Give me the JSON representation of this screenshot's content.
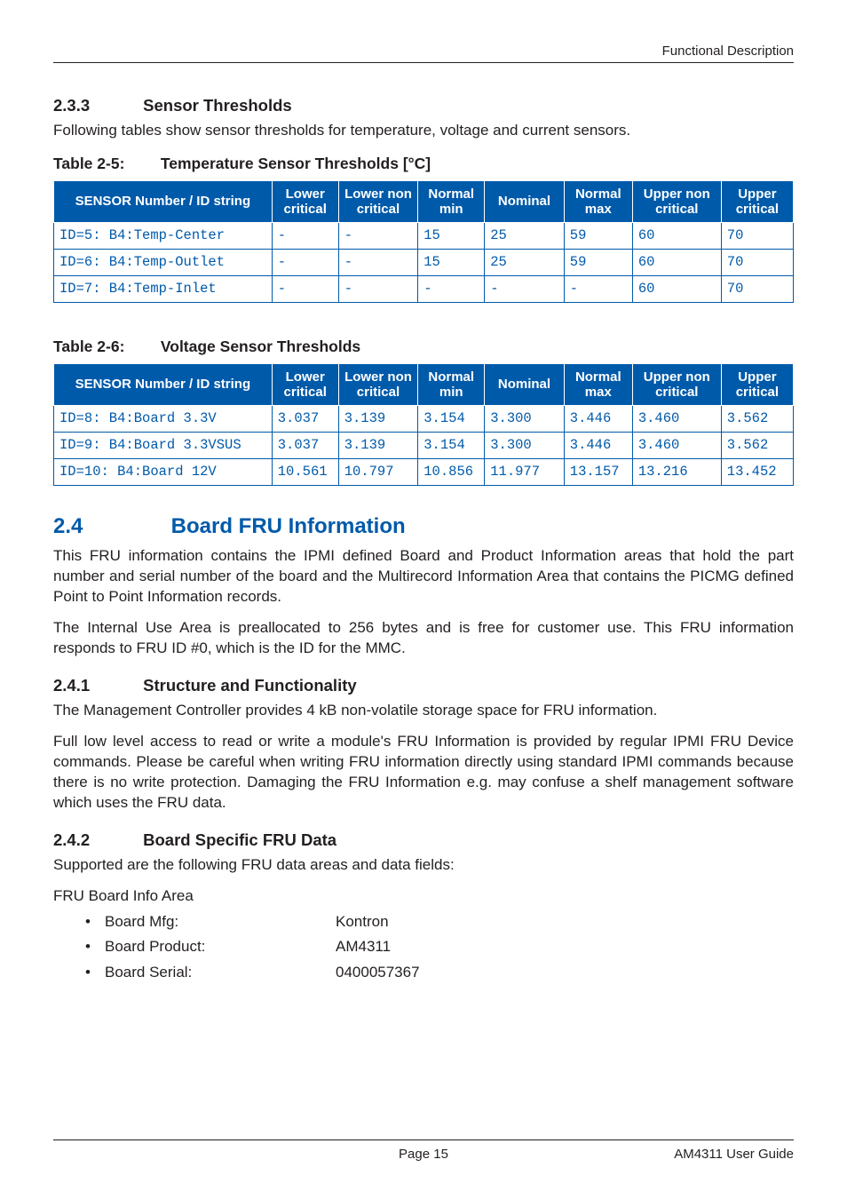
{
  "running_header": "Functional Description",
  "sections": {
    "s233": {
      "number": "2.3.3",
      "title": "Sensor Thresholds"
    },
    "s233_para": "Following tables show sensor thresholds for temperature, voltage and current sensors.",
    "table25_caption_num": "Table 2-5:",
    "table25_caption": "Temperature Sensor Thresholds [°C]",
    "table26_caption_num": "Table 2-6:",
    "table26_caption": "Voltage Sensor Thresholds",
    "s24": {
      "number": "2.4",
      "title": "Board FRU Information"
    },
    "s24_para1": "This FRU information contains the IPMI defined Board and Product Information areas that hold the part number and serial number of the board and the Multirecord Information Area that contains the PICMG defined Point to Point Information records.",
    "s24_para2": "The Internal Use Area is preallocated to 256 bytes and is free for customer use. This FRU information responds to FRU ID #0, which is the ID for the MMC.",
    "s241": {
      "number": "2.4.1",
      "title": "Structure and Functionality"
    },
    "s241_para1": "The Management Controller provides 4 kB non-volatile storage space for FRU information.",
    "s241_para2": "Full low level access to read or write a module's FRU Information is provided by regular IPMI FRU Device commands. Please be careful when writing FRU information directly using standard IPMI commands because there is no write protection. Damaging the FRU Information e.g. may confuse a shelf management software which uses the FRU data.",
    "s242": {
      "number": "2.4.2",
      "title": "Board Specific FRU Data"
    },
    "s242_para1": "Supported are the following FRU data areas and data fields:",
    "s242_sub": "FRU Board Info Area"
  },
  "table_headers": {
    "c0": "SENSOR Number / ID string",
    "c1": "Lower critical",
    "c2": "Lower non critical",
    "c3": "Normal min",
    "c4": "Nominal",
    "c5": "Normal max",
    "c6": "Upper non critical",
    "c7": "Upper critical"
  },
  "table25_rows": [
    {
      "c0": "ID=5: B4:Temp-Center",
      "c1": "-",
      "c2": "-",
      "c3": "15",
      "c4": "25",
      "c5": "59",
      "c6": "60",
      "c7": "70"
    },
    {
      "c0": "ID=6: B4:Temp-Outlet",
      "c1": "-",
      "c2": "-",
      "c3": "15",
      "c4": "25",
      "c5": "59",
      "c6": "60",
      "c7": "70"
    },
    {
      "c0": "ID=7: B4:Temp-Inlet",
      "c1": "-",
      "c2": "-",
      "c3": "-",
      "c4": "-",
      "c5": "-",
      "c6": "60",
      "c7": "70"
    }
  ],
  "table26_rows": [
    {
      "c0": "ID=8: B4:Board 3.3V",
      "c1": "3.037",
      "c2": "3.139",
      "c3": "3.154",
      "c4": "3.300",
      "c5": "3.446",
      "c6": "3.460",
      "c7": "3.562"
    },
    {
      "c0": "ID=9: B4:Board 3.3VSUS",
      "c1": "3.037",
      "c2": "3.139",
      "c3": "3.154",
      "c4": "3.300",
      "c5": "3.446",
      "c6": "3.460",
      "c7": "3.562"
    },
    {
      "c0": "ID=10: B4:Board 12V",
      "c1": "10.561",
      "c2": "10.797",
      "c3": "10.856",
      "c4": "11.977",
      "c5": "13.157",
      "c6": "13.216",
      "c7": "13.452"
    }
  ],
  "fru_list": [
    {
      "label": "Board Mfg:",
      "value": "Kontron"
    },
    {
      "label": "Board Product:",
      "value": "AM4311"
    },
    {
      "label": "Board Serial:",
      "value": "0400057367"
    }
  ],
  "footer": {
    "page": "Page 15",
    "doc": "AM4311 User Guide"
  }
}
